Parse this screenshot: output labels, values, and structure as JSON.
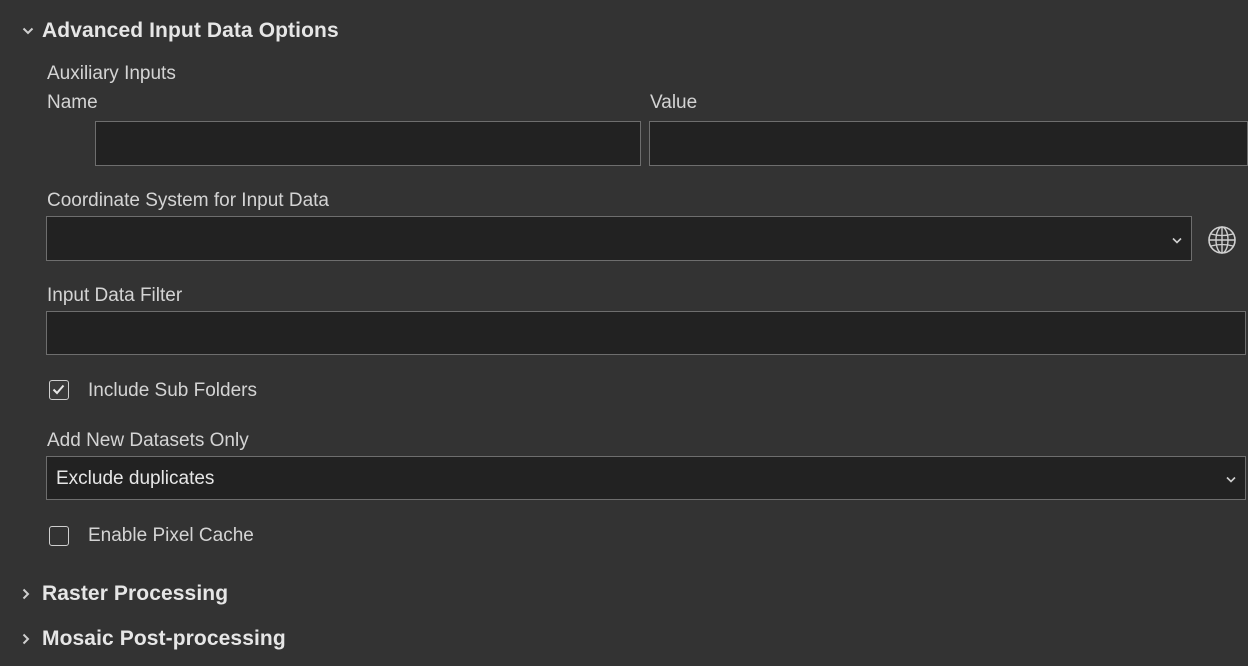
{
  "sections": {
    "advanced": {
      "title": "Advanced Input Data Options",
      "expanded": true
    },
    "raster": {
      "title": "Raster Processing",
      "expanded": false
    },
    "mosaic": {
      "title": "Mosaic Post-processing",
      "expanded": false
    }
  },
  "auxiliary_inputs": {
    "label": "Auxiliary Inputs",
    "columns": {
      "name": "Name",
      "value": "Value"
    },
    "row": {
      "name": "",
      "value": ""
    }
  },
  "coordinate_system": {
    "label": "Coordinate System for Input Data",
    "value": "",
    "icon": "globe-icon"
  },
  "input_data_filter": {
    "label": "Input Data Filter",
    "value": ""
  },
  "include_sub_folders": {
    "label": "Include Sub Folders",
    "checked": true
  },
  "add_new_datasets_only": {
    "label": "Add New Datasets Only",
    "value": "Exclude duplicates"
  },
  "enable_pixel_cache": {
    "label": "Enable Pixel Cache",
    "checked": false
  },
  "colors": {
    "background": "#333333",
    "field": "#222222",
    "border": "#6e6e6e",
    "text": "#d4d4d4"
  }
}
